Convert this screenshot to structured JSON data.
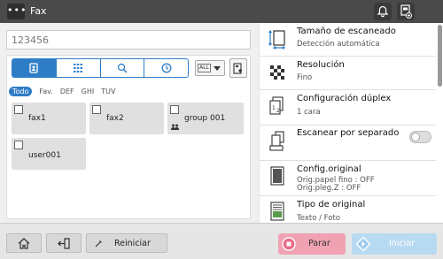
{
  "header": {
    "menu_label": "•••",
    "title": "Fax"
  },
  "destination": {
    "value": "",
    "placeholder": "123456"
  },
  "search_tabs": [
    {
      "name": "address-book-icon"
    },
    {
      "name": "keypad-icon"
    },
    {
      "name": "search-icon"
    },
    {
      "name": "history-icon"
    }
  ],
  "filter": {
    "value": "ALL"
  },
  "index_tabs": [
    "Todo",
    "Fav.",
    "DEF",
    "GHI",
    "TUV"
  ],
  "addresses": [
    {
      "name": "fax1"
    },
    {
      "name": "fax2"
    },
    {
      "name": "group 001"
    },
    {
      "name": "user001"
    }
  ],
  "settings": [
    {
      "title": "Tamaño de escaneado",
      "sub": "Detección automática"
    },
    {
      "title": "Resolución",
      "sub": "Fino"
    },
    {
      "title": "Configuración dúplex",
      "sub": "1 cara"
    },
    {
      "title": "Escanear por separado"
    },
    {
      "title": "Config.original",
      "sub": "Orig.papel fino : OFF",
      "sub2": "Orig.pleg.Z : OFF"
    },
    {
      "title": "Tipo de original",
      "sub": "Texto / Foto"
    }
  ],
  "toggle": {
    "on": false
  },
  "bottom": {
    "reset_label": "Reiniciar",
    "stop_label": "Parar",
    "start_label": "Iniciar"
  },
  "colors": {
    "accent": "#2f7dc7",
    "stop": "#f0a2b3",
    "start": "#b8d9f2"
  }
}
